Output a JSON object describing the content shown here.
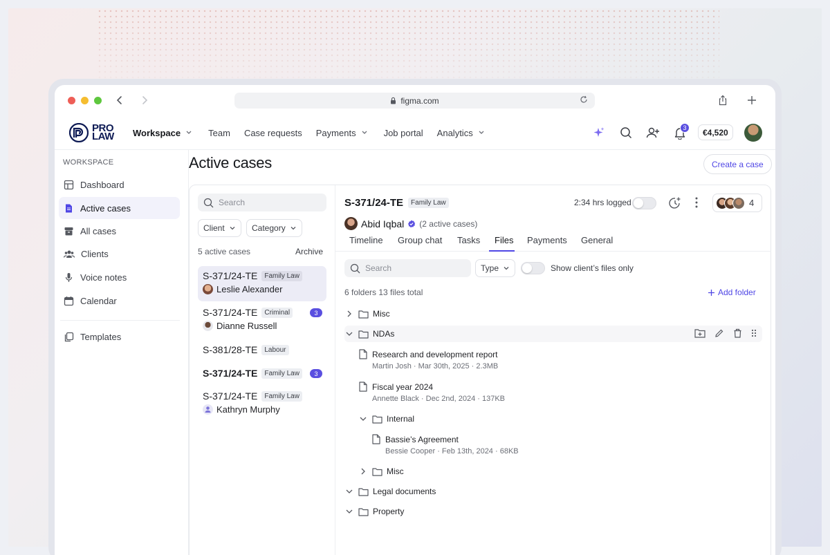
{
  "browser": {
    "url": "figma.com"
  },
  "brand": {
    "logo_top": "PRO",
    "logo_bottom": "LAW",
    "accent": "#4f46e5",
    "navy": "#0d1a54"
  },
  "topnav": {
    "items": [
      {
        "label": "Workspace",
        "has_dropdown": true
      },
      {
        "label": "Team"
      },
      {
        "label": "Case requests"
      },
      {
        "label": "Payments",
        "has_dropdown": true
      },
      {
        "label": "Job portal"
      },
      {
        "label": "Analytics",
        "has_dropdown": true
      }
    ],
    "notifications_count": "3",
    "balance": "€4,520"
  },
  "sidebar": {
    "heading": "WORKSPACE",
    "items": [
      {
        "label": "Dashboard",
        "icon": "dashboard-icon"
      },
      {
        "label": "Active cases",
        "icon": "document-icon",
        "active": true
      },
      {
        "label": "All cases",
        "icon": "archive-icon"
      },
      {
        "label": "Clients",
        "icon": "people-icon"
      },
      {
        "label": "Voice notes",
        "icon": "microphone-icon"
      },
      {
        "label": "Calendar",
        "icon": "calendar-icon"
      },
      {
        "label": "Templates",
        "icon": "copy-icon"
      }
    ]
  },
  "page": {
    "title": "Active cases",
    "create_button": "Create a case"
  },
  "case_list": {
    "search_placeholder": "Search",
    "filters": [
      "Client",
      "Category"
    ],
    "count_label": "5 active cases",
    "archive_label": "Archive",
    "cases": [
      {
        "id": "S-371/24-TE",
        "tag": "Family Law",
        "client": "Leslie Alexander",
        "active": true
      },
      {
        "id": "S-371/24-TE",
        "tag": "Criminal",
        "client": "Dianne Russell",
        "unread": "3"
      },
      {
        "id": "S-381/28-TE",
        "tag": "Labour"
      },
      {
        "id": "S-371/24-TE",
        "tag": "Family Law",
        "unread": "3",
        "bold": true
      },
      {
        "id": "S-371/24-TE",
        "tag": "Family Law",
        "client": "Kathryn Murphy"
      }
    ]
  },
  "case_detail": {
    "id": "S-371/24-TE",
    "tag": "Family Law",
    "logged": "2:34 hrs logged",
    "team_count": "4",
    "client_name": "Abid Iqbal",
    "client_sub": "(2 active cases)",
    "tabs": [
      "Timeline",
      "Group chat",
      "Tasks",
      "Files",
      "Payments",
      "General"
    ],
    "active_tab": "Files",
    "files": {
      "search_placeholder": "Search",
      "type_filter": "Type",
      "toggle_label": "Show client’s files only",
      "summary": "6 folders 13 files total",
      "add_folder": "Add folder",
      "tree": {
        "misc_top": "Misc",
        "ndas": "NDAs",
        "file1": {
          "name": "Research and development report",
          "meta": "Martin Josh · Mar 30th, 2025 · 2.3MB"
        },
        "file2": {
          "name": "Fiscal year 2024",
          "meta": "Annette Black · Dec 2nd, 2024 · 137KB"
        },
        "internal": "Internal",
        "file3": {
          "name": "Bassie’s Agreement",
          "meta": "Bessie Cooper · Feb 13th, 2024 · 68KB"
        },
        "misc_nested": "Misc",
        "legal": "Legal documents",
        "property": "Property"
      }
    }
  }
}
